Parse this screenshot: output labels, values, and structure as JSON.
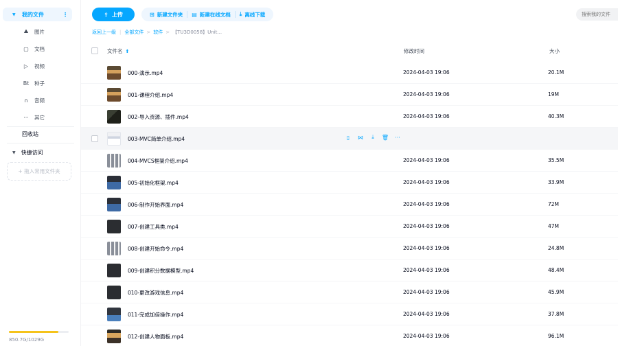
{
  "sidebar": {
    "root_label": "我的文件",
    "items": [
      {
        "icon": "image-icon",
        "glyph": "⛰",
        "label": "图片"
      },
      {
        "icon": "document-icon",
        "glyph": "▢",
        "label": "文档"
      },
      {
        "icon": "video-icon",
        "glyph": "▷",
        "label": "视频"
      },
      {
        "icon": "torrent-icon",
        "glyph": "Bt",
        "label": "种子"
      },
      {
        "icon": "audio-icon",
        "glyph": "∩",
        "label": "音频"
      },
      {
        "icon": "more-icon",
        "glyph": "···",
        "label": "其它"
      }
    ],
    "recycle_label": "回收站",
    "quick_access_label": "快捷访问",
    "drop_hint": "+ 拖入常用文件夹",
    "quota_text": "850.7G/1029G",
    "quota_used_fraction": 0.827
  },
  "toolbar": {
    "upload_label": "上传",
    "new_folder_label": "新建文件夹",
    "new_doc_label": "新建在线文档",
    "offline_download_label": "离线下载"
  },
  "search": {
    "placeholder": "搜索我的文件"
  },
  "breadcrumb": {
    "back_label": "返回上一级",
    "all_files_label": "全部文件",
    "folder_label": "软件",
    "current_label": "【TU3D0058】Unit..."
  },
  "table": {
    "col_name": "文件名",
    "col_modified": "修改时间",
    "col_size": "大小",
    "rows": [
      {
        "name": "000-演示.mp4",
        "modified": "2024-04-03 19:06",
        "size": "20.1M",
        "thumb": "video-warm"
      },
      {
        "name": "001-课程介绍.mp4",
        "modified": "2024-04-03 19:06",
        "size": "19M",
        "thumb": "video-warm"
      },
      {
        "name": "002-导入资源、插件.mp4",
        "modified": "2024-04-03 19:06",
        "size": "40.3M",
        "thumb": "video-dark"
      },
      {
        "name": "003-MVC简单介绍.mp4",
        "modified": "",
        "size": "",
        "thumb": "video-light",
        "hover": true
      },
      {
        "name": "004-MVCS框架介绍.mp4",
        "modified": "2024-04-03 19:06",
        "size": "35.5M",
        "thumb": "video-grid"
      },
      {
        "name": "005-初始化框架.mp4",
        "modified": "2024-04-03 19:06",
        "size": "33.9M",
        "thumb": "video-blue"
      },
      {
        "name": "006-制作开始界面.mp4",
        "modified": "2024-04-03 19:06",
        "size": "72M",
        "thumb": "video-blue"
      },
      {
        "name": "007-创建工具类.mp4",
        "modified": "2024-04-03 19:06",
        "size": "47M",
        "thumb": "video-black"
      },
      {
        "name": "008-创建开始命令.mp4",
        "modified": "2024-04-03 19:06",
        "size": "24.8M",
        "thumb": "video-grid"
      },
      {
        "name": "009-创建积分数据模型.mp4",
        "modified": "2024-04-03 19:06",
        "size": "48.4M",
        "thumb": "video-black"
      },
      {
        "name": "010-更改游戏信息.mp4",
        "modified": "2024-04-03 19:06",
        "size": "45.9M",
        "thumb": "video-black"
      },
      {
        "name": "011-完成加倍操作.mp4",
        "modified": "2024-04-03 19:06",
        "size": "37.8M",
        "thumb": "video-blue2"
      },
      {
        "name": "012-创建人物面板.mp4",
        "modified": "2024-04-03 19:06",
        "size": "96.1M",
        "thumb": "video-warm2"
      }
    ]
  },
  "row_actions": [
    {
      "icon": "phone-icon",
      "glyph": "▯"
    },
    {
      "icon": "share-icon",
      "glyph": "⋈"
    },
    {
      "icon": "download-icon",
      "glyph": "⤓"
    },
    {
      "icon": "delete-icon",
      "glyph": "🗑"
    },
    {
      "icon": "more-icon",
      "glyph": "···"
    }
  ],
  "colors": {
    "accent": "#06a7ff",
    "accent_light": "#eef6fe",
    "quota": "#f5c31b"
  }
}
